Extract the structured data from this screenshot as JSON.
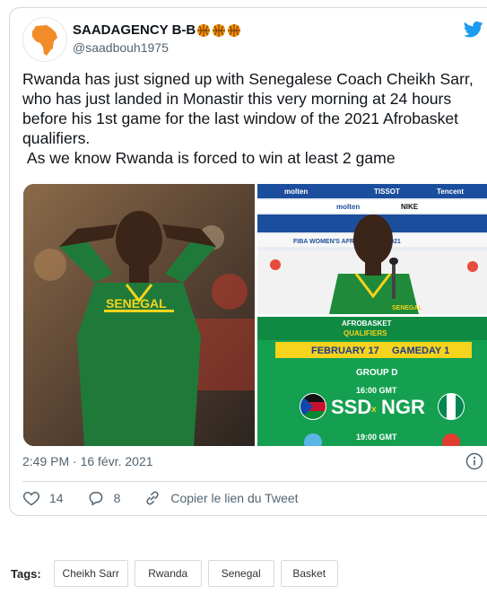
{
  "tweet": {
    "display_name": "SAADAGENCY B-B",
    "name_emoji": [
      "basketball-icon",
      "basketball-icon",
      "basketball-icon"
    ],
    "handle": "@saadbouh1975",
    "text": "Rwanda has just signed up with Senegalese Coach Cheikh Sarr, who has just landed in Monastir this very morning at 24 hours before his 1st game for the last window of the 2021 Afrobasket qualifiers.\n As we know Rwanda is forced to win at least 2 game",
    "timestamp": "2:49 PM · 16 févr. 2021",
    "likes": "14",
    "replies": "8",
    "copy_link": "Copier le lien du Tweet"
  },
  "media": {
    "left_shirt_text": "SENEGAL",
    "top_right": {
      "sponsors": [
        "molten",
        "TISSOT",
        "Tencent",
        "molten",
        "NIKE"
      ],
      "banner": "FIBA WOMEN'S AFROBASKET 2021",
      "shirt_text": "SENEGAL"
    },
    "graphic": {
      "event_title": "AFROBASKET",
      "event_sub": "QUALIFIERS",
      "date": "FEBRUARY 17",
      "gameday": "GAMEDAY 1",
      "group": "GROUP D",
      "time1": "16:00 GMT",
      "home1": "SSD",
      "vs": "x",
      "away1": "NGR",
      "time2": "19:00 GMT",
      "colors": {
        "green": "#14a050",
        "yellow": "#f6d31c",
        "navy": "#1d3b8b"
      }
    }
  },
  "tags": {
    "label": "Tags:",
    "items": [
      "Cheikh Sarr",
      "Rwanda",
      "Senegal",
      "Basket"
    ]
  },
  "colors": {
    "twitter_blue": "#1d9bf0",
    "text": "#0f1419",
    "muted": "#536471",
    "border": "#cfd9de"
  }
}
